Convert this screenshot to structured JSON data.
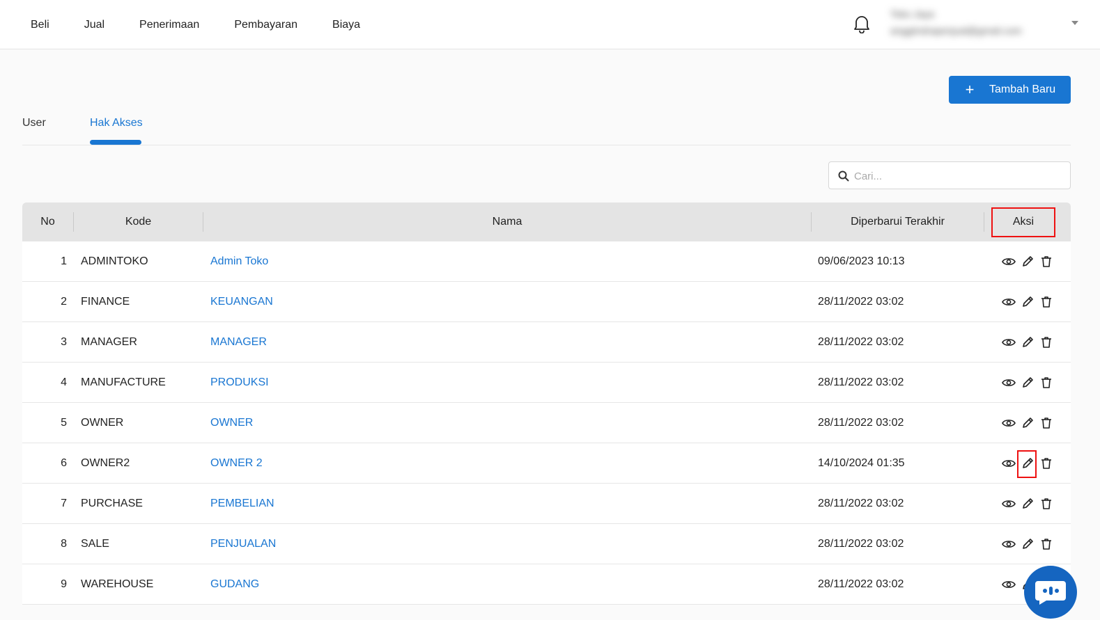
{
  "nav": {
    "items": [
      "Beli",
      "Jual",
      "Penerimaan",
      "Pembayaran",
      "Biaya"
    ]
  },
  "user": {
    "name": "Toko Jaya",
    "email": "anggiindrapenjual@gmail.com"
  },
  "toolbar": {
    "add_label": "Tambah Baru"
  },
  "tabs": {
    "user": "User",
    "hak_akses": "Hak Akses",
    "active": "Hak Akses"
  },
  "search": {
    "placeholder": "Cari..."
  },
  "table": {
    "headers": {
      "no": "No",
      "kode": "Kode",
      "nama": "Nama",
      "date": "Diperbarui Terakhir",
      "aksi": "Aksi"
    },
    "rows": [
      {
        "no": "1",
        "kode": "ADMINTOKO",
        "nama": "Admin Toko",
        "date": "09/06/2023 10:13"
      },
      {
        "no": "2",
        "kode": "FINANCE",
        "nama": "KEUANGAN",
        "date": "28/11/2022 03:02"
      },
      {
        "no": "3",
        "kode": "MANAGER",
        "nama": "MANAGER",
        "date": "28/11/2022 03:02"
      },
      {
        "no": "4",
        "kode": "MANUFACTURE",
        "nama": "PRODUKSI",
        "date": "28/11/2022 03:02"
      },
      {
        "no": "5",
        "kode": "OWNER",
        "nama": "OWNER",
        "date": "28/11/2022 03:02"
      },
      {
        "no": "6",
        "kode": "OWNER2",
        "nama": "OWNER 2",
        "date": "14/10/2024 01:35"
      },
      {
        "no": "7",
        "kode": "PURCHASE",
        "nama": "PEMBELIAN",
        "date": "28/11/2022 03:02"
      },
      {
        "no": "8",
        "kode": "SALE",
        "nama": "PENJUALAN",
        "date": "28/11/2022 03:02"
      },
      {
        "no": "9",
        "kode": "WAREHOUSE",
        "nama": "GUDANG",
        "date": "28/11/2022 03:02"
      }
    ]
  },
  "colors": {
    "accent": "#1976d2",
    "highlight": "#e11111",
    "chat": "#1565c0"
  },
  "icons": {
    "view": "eye-icon",
    "edit": "pencil-icon",
    "delete": "trash-icon",
    "notify": "bell-icon",
    "search": "search-icon",
    "chat": "chat-icon"
  }
}
